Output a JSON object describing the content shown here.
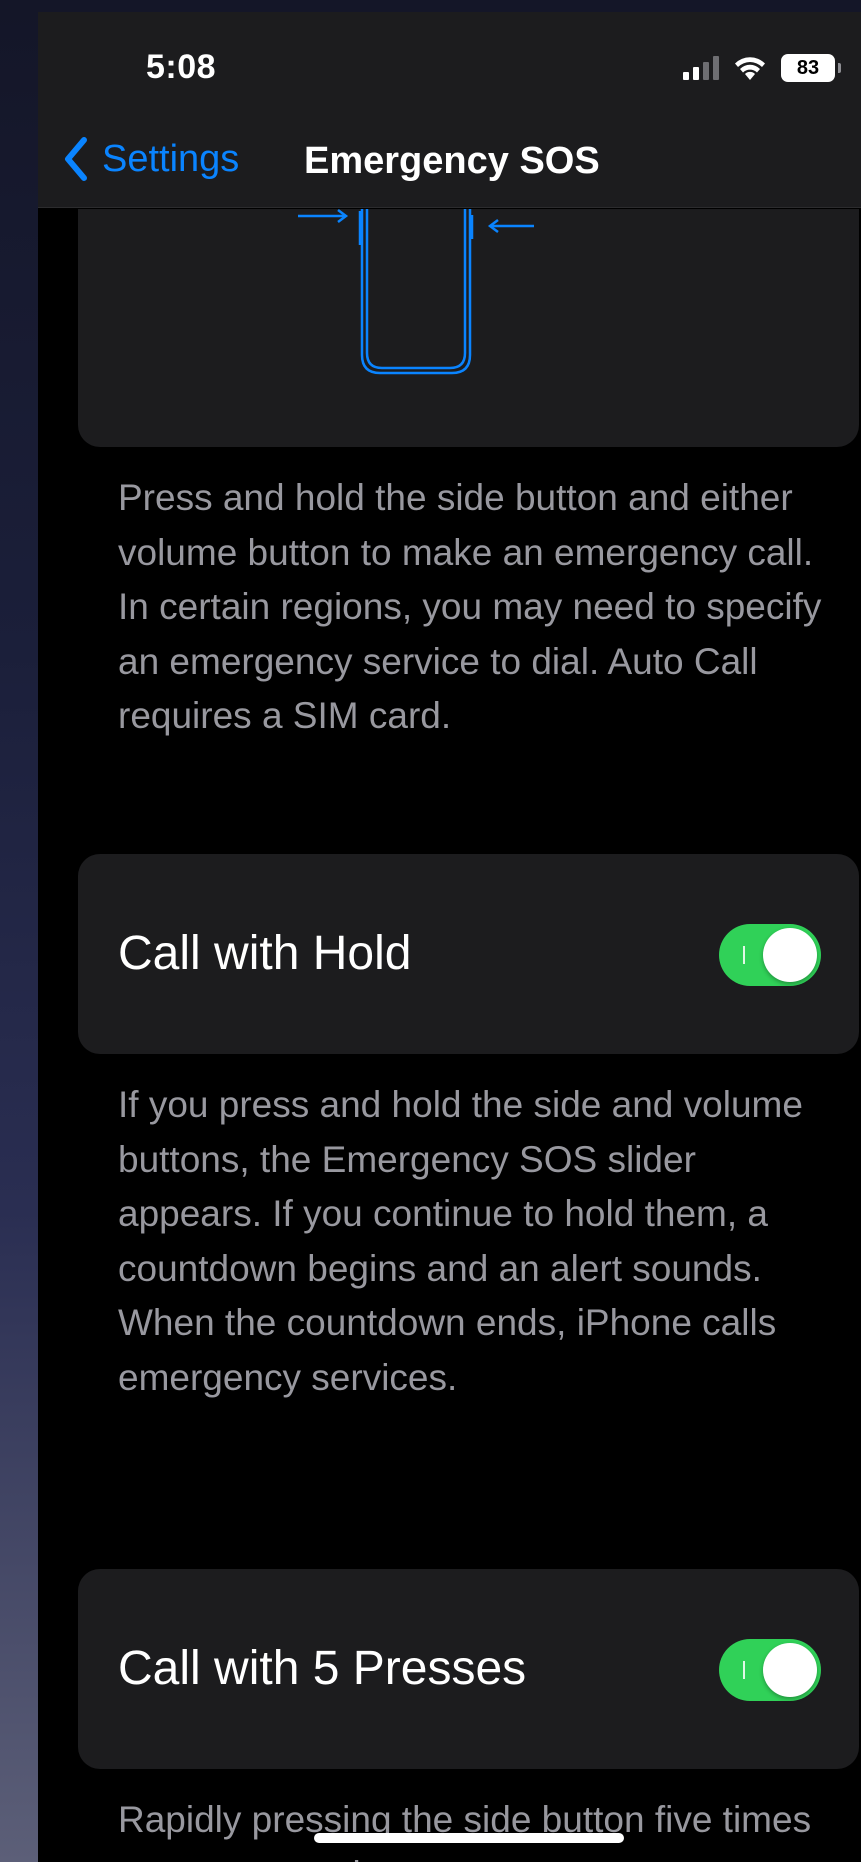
{
  "status_bar": {
    "time": "5:08",
    "battery": "83",
    "signal_bars": 4,
    "signal_active": 2
  },
  "nav": {
    "back_label": "Settings",
    "title": "Emergency SOS"
  },
  "sections": {
    "call_description": "Press and hold the side button and either volume button to make an emergency call. In certain regions, you may need to specify an emergency service to dial. Auto Call requires a SIM card.",
    "call_with_hold": {
      "label": "Call with Hold",
      "enabled": true,
      "description": "If you press and hold the side and volume buttons, the Emergency SOS slider appears. If you continue to hold them, a countdown begins and an alert sounds. When the countdown ends, iPhone calls emergency services."
    },
    "call_with_5_presses": {
      "label": "Call with 5 Presses",
      "enabled": true,
      "description": "Rapidly pressing the side button five times starts a countdown"
    }
  },
  "colors": {
    "accent": "#0a84ff",
    "toggle_on": "#30d158",
    "card_bg": "#1c1c1e",
    "footnote": "#98989f"
  },
  "icons": {
    "back": "chevron-left-icon",
    "signal": "cellular-signal-icon",
    "wifi": "wifi-icon",
    "battery": "battery-icon"
  }
}
